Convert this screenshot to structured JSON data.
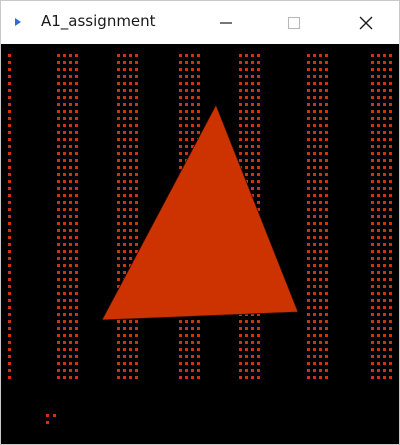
{
  "window": {
    "title": "A1_assignment",
    "icon": "app-window-icon",
    "controls": {
      "minimize_icon": "minimize-icon",
      "maximize_icon": "maximize-icon",
      "close_icon": "close-icon"
    }
  },
  "canvas": {
    "background_color": "#000000",
    "dot_color": "#cc3311",
    "triangle_color": "#cc3300"
  }
}
